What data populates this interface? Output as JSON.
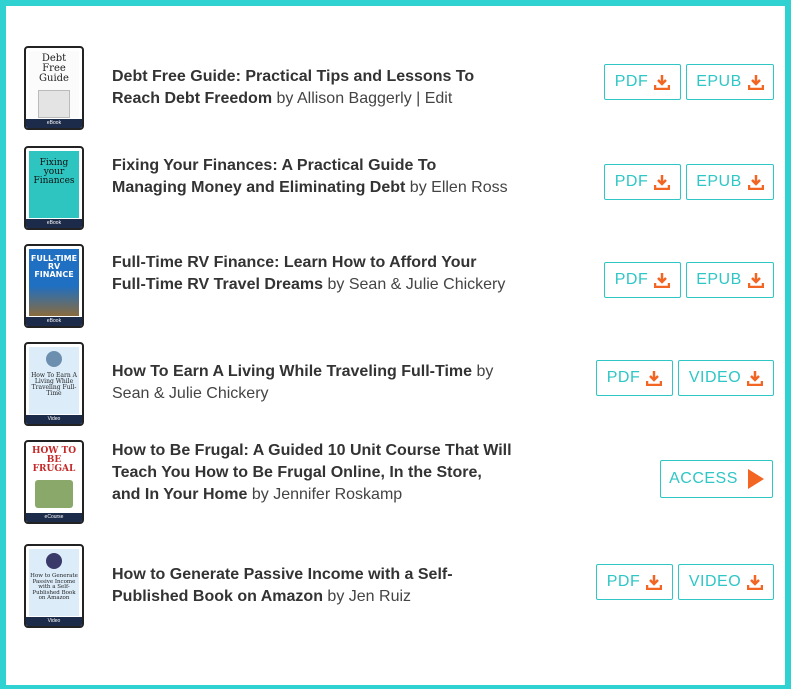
{
  "items": [
    {
      "title": "Debt Free Guide: Practical Tips and Lessons To Reach Debt Freedom",
      "author": "by Allison Baggerly | Edit",
      "cover": {
        "title": "Debt Free Guide",
        "foot": "eBook"
      },
      "buttons": [
        "PDF",
        "EPUB"
      ]
    },
    {
      "title": "Fixing Your Finances: A Practical Guide To Managing Money and Eliminating Debt",
      "author": "by Ellen Ross",
      "cover": {
        "title": "Fixing your Finances",
        "foot": "eBook"
      },
      "buttons": [
        "PDF",
        "EPUB"
      ]
    },
    {
      "title": "Full-Time RV Finance: Learn How to Afford Your Full-Time RV Travel Dreams",
      "author": "by Sean & Julie Chickery",
      "cover": {
        "title": "FULL-TIME RV FINANCE",
        "foot": "eBook"
      },
      "buttons": [
        "PDF",
        "EPUB"
      ]
    },
    {
      "title": "How To Earn A Living While Traveling Full-Time",
      "author": "by Sean & Julie Chickery",
      "cover": {
        "title": "How To Earn A Living While Traveling Full-Time",
        "foot": "Video"
      },
      "buttons": [
        "PDF",
        "VIDEO"
      ]
    },
    {
      "title": "How to Be Frugal: A Guided 10 Unit Course That Will Teach You How to Be Frugal Online, In the Store, and In Your Home",
      "author": "by Jennifer Roskamp",
      "cover": {
        "title": "HOW TO BE FRUGAL",
        "foot": "eCourse"
      },
      "buttons": [
        "ACCESS"
      ]
    },
    {
      "title": "How to Generate Passive Income with a Self-Published Book on Amazon",
      "author": "by Jen Ruiz",
      "cover": {
        "title": "How to Generate Passive Income with a Self-Published Book on Amazon",
        "foot": "Video"
      },
      "buttons": [
        "PDF",
        "VIDEO"
      ]
    }
  ],
  "colors": {
    "accent": "#2fc6c6",
    "icon": "#f26522",
    "border": "#2fd1d1"
  }
}
